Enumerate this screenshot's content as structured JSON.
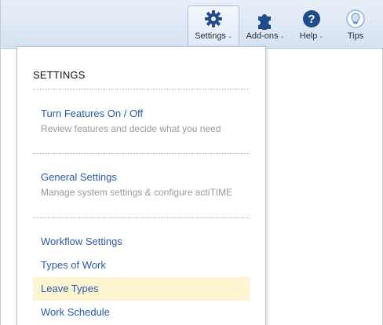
{
  "toolbar": {
    "settings_label": "Settings",
    "addons_label": "Add-ons",
    "help_label": "Help",
    "tips_label": "Tips",
    "caret": "⌄",
    "accent": "#1f4d8c"
  },
  "settings_menu": {
    "title": "SETTINGS",
    "sections": [
      {
        "link": "Turn Features On / Off",
        "description": "Review features and decide what you need"
      },
      {
        "link": "General Settings",
        "description": "Manage system settings & configure actiTIME"
      }
    ],
    "items": [
      {
        "label": "Workflow Settings",
        "highlighted": false
      },
      {
        "label": "Types of Work",
        "highlighted": false
      },
      {
        "label": "Leave Types",
        "highlighted": true
      },
      {
        "label": "Work Schedule",
        "highlighted": false
      }
    ],
    "link_color": "#2a5aa8",
    "highlight_color": "#fdf5cf"
  }
}
